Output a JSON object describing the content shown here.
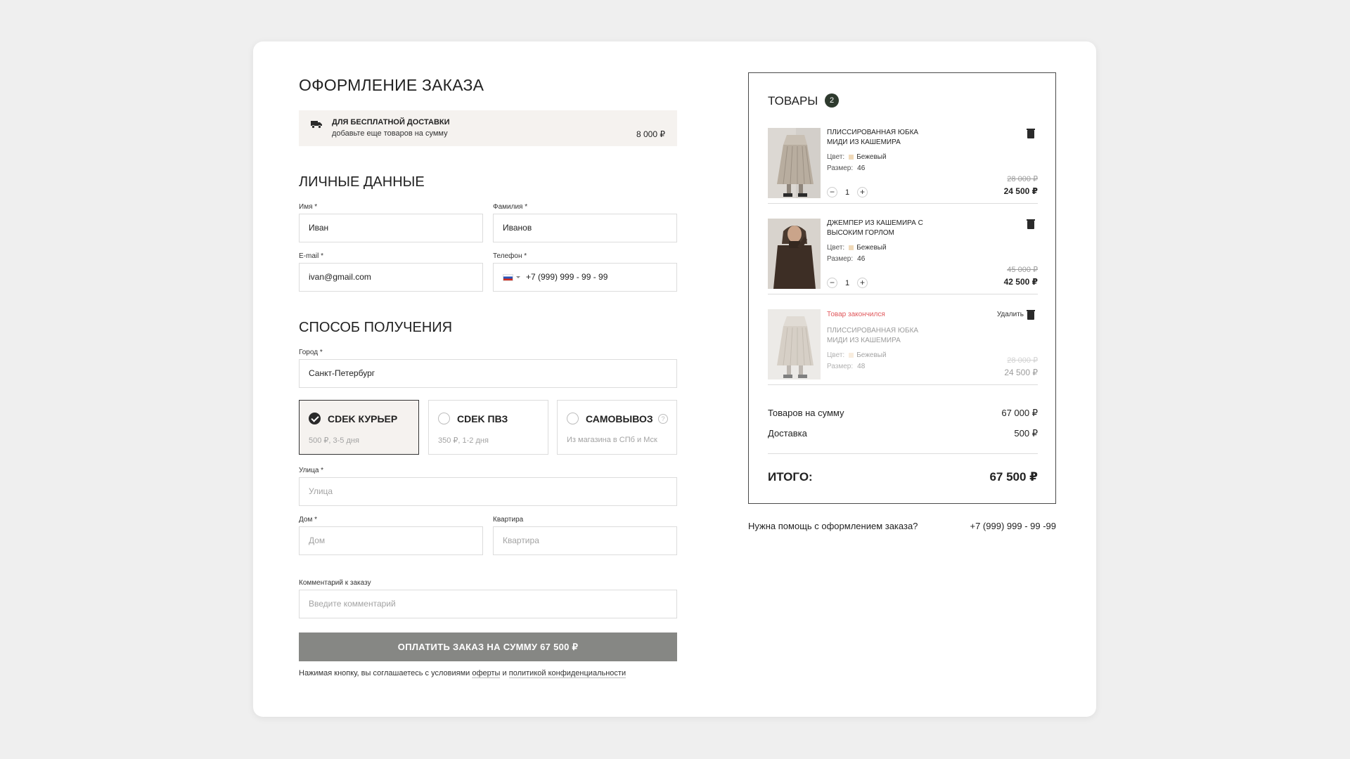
{
  "title": "ОФОРМЛЕНИЕ ЗАКАЗА",
  "banner": {
    "title": "ДЛЯ БЕСПЛАТНОЙ ДОСТАВКИ",
    "subtitle": "добавьте еще товаров на сумму",
    "amount": "8 000 ₽",
    "icon": "truck-icon"
  },
  "personal": {
    "heading": "ЛИЧНЫЕ ДАННЫЕ",
    "first_name": {
      "label": "Имя *",
      "value": "Иван"
    },
    "last_name": {
      "label": "Фамилия *",
      "value": "Иванов"
    },
    "email": {
      "label": "E-mail *",
      "value": "ivan@gmail.com"
    },
    "phone": {
      "label": "Телефон *",
      "value": "+7 (999) 999 - 99 - 99"
    }
  },
  "delivery": {
    "heading": "СПОСОБ ПОЛУЧЕНИЯ",
    "city": {
      "label": "Город *",
      "value": "Санкт-Петербург"
    },
    "options": [
      {
        "title": "CDEK КУРЬЕР",
        "subtitle": "500 ₽, 3-5 дня",
        "selected": true
      },
      {
        "title": "CDEK ПВЗ",
        "subtitle": "350 ₽, 1-2 дня",
        "selected": false
      },
      {
        "title": "САМОВЫВОЗ",
        "subtitle": "Из магазина в СПб и Мск",
        "selected": false
      }
    ],
    "street": {
      "label": "Улица *",
      "placeholder": "Улица"
    },
    "house": {
      "label": "Дом *",
      "placeholder": "Дом"
    },
    "apartment": {
      "label": "Квартира",
      "placeholder": "Квартира"
    },
    "comment": {
      "label": "Комментарий к заказу",
      "placeholder": "Введите комментарий"
    }
  },
  "pay_button": "ОПЛАТИТЬ ЗАКАЗ НА СУММУ 67 500 ₽",
  "agreement": {
    "prefix": "Нажимая кнопку, вы соглашаетесь с условиями",
    "offer_link": "оферты",
    "and": "и",
    "privacy_link": "политикой конфиденциальности"
  },
  "cart": {
    "title": "ТОВАРЫ",
    "count": "2",
    "color_label": "Цвет:",
    "size_label": "Размер:",
    "items": [
      {
        "name": "ПЛИССИРОВАННАЯ ЮБКА МИДИ ИЗ КАШЕМИРА",
        "color": "Бежевый",
        "size": "46",
        "qty": "1",
        "old_price": "28 000 ₽",
        "price": "24 500 ₽"
      },
      {
        "name": "ДЖЕМПЕР ИЗ КАШЕМИРА С ВЫСОКИМ ГОРЛОМ",
        "color": "Бежевый",
        "size": "46",
        "qty": "1",
        "old_price": "45 000 ₽",
        "price": "42 500 ₽"
      },
      {
        "name": "ПЛИССИРОВАННАЯ ЮБКА МИДИ ИЗ КАШЕМИРА",
        "color": "Бежевый",
        "size": "48",
        "old_price": "28 000 ₽",
        "price": "24 500 ₽",
        "status": "Товар закончился",
        "remove": "Удалить"
      }
    ],
    "subtotal_label": "Товаров на сумму",
    "subtotal": "67 000 ₽",
    "delivery_label": "Доставка",
    "delivery": "500 ₽",
    "total_label": "ИТОГО:",
    "total": "67 500 ₽"
  },
  "help": {
    "text": "Нужна помощь с оформлением заказа?",
    "phone": "+7 (999) 999 - 99 -99"
  },
  "colors": {
    "background": "#efefef",
    "banner": "#f5f2ef",
    "button": "#868784",
    "badge": "#2e3a2e",
    "error": "#e0575b",
    "swatch": "#f0d9b8"
  }
}
